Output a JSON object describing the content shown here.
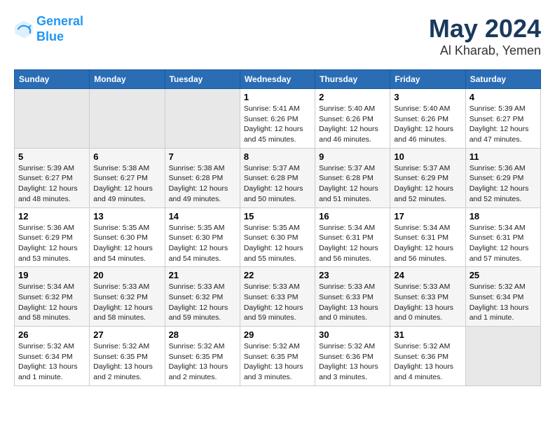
{
  "logo": {
    "line1": "General",
    "line2": "Blue"
  },
  "title": "May 2024",
  "subtitle": "Al Kharab, Yemen",
  "weekdays": [
    "Sunday",
    "Monday",
    "Tuesday",
    "Wednesday",
    "Thursday",
    "Friday",
    "Saturday"
  ],
  "weeks": [
    [
      {
        "day": "",
        "info": ""
      },
      {
        "day": "",
        "info": ""
      },
      {
        "day": "",
        "info": ""
      },
      {
        "day": "1",
        "info": "Sunrise: 5:41 AM\nSunset: 6:26 PM\nDaylight: 12 hours\nand 45 minutes."
      },
      {
        "day": "2",
        "info": "Sunrise: 5:40 AM\nSunset: 6:26 PM\nDaylight: 12 hours\nand 46 minutes."
      },
      {
        "day": "3",
        "info": "Sunrise: 5:40 AM\nSunset: 6:26 PM\nDaylight: 12 hours\nand 46 minutes."
      },
      {
        "day": "4",
        "info": "Sunrise: 5:39 AM\nSunset: 6:27 PM\nDaylight: 12 hours\nand 47 minutes."
      }
    ],
    [
      {
        "day": "5",
        "info": "Sunrise: 5:39 AM\nSunset: 6:27 PM\nDaylight: 12 hours\nand 48 minutes."
      },
      {
        "day": "6",
        "info": "Sunrise: 5:38 AM\nSunset: 6:27 PM\nDaylight: 12 hours\nand 49 minutes."
      },
      {
        "day": "7",
        "info": "Sunrise: 5:38 AM\nSunset: 6:28 PM\nDaylight: 12 hours\nand 49 minutes."
      },
      {
        "day": "8",
        "info": "Sunrise: 5:37 AM\nSunset: 6:28 PM\nDaylight: 12 hours\nand 50 minutes."
      },
      {
        "day": "9",
        "info": "Sunrise: 5:37 AM\nSunset: 6:28 PM\nDaylight: 12 hours\nand 51 minutes."
      },
      {
        "day": "10",
        "info": "Sunrise: 5:37 AM\nSunset: 6:29 PM\nDaylight: 12 hours\nand 52 minutes."
      },
      {
        "day": "11",
        "info": "Sunrise: 5:36 AM\nSunset: 6:29 PM\nDaylight: 12 hours\nand 52 minutes."
      }
    ],
    [
      {
        "day": "12",
        "info": "Sunrise: 5:36 AM\nSunset: 6:29 PM\nDaylight: 12 hours\nand 53 minutes."
      },
      {
        "day": "13",
        "info": "Sunrise: 5:35 AM\nSunset: 6:30 PM\nDaylight: 12 hours\nand 54 minutes."
      },
      {
        "day": "14",
        "info": "Sunrise: 5:35 AM\nSunset: 6:30 PM\nDaylight: 12 hours\nand 54 minutes."
      },
      {
        "day": "15",
        "info": "Sunrise: 5:35 AM\nSunset: 6:30 PM\nDaylight: 12 hours\nand 55 minutes."
      },
      {
        "day": "16",
        "info": "Sunrise: 5:34 AM\nSunset: 6:31 PM\nDaylight: 12 hours\nand 56 minutes."
      },
      {
        "day": "17",
        "info": "Sunrise: 5:34 AM\nSunset: 6:31 PM\nDaylight: 12 hours\nand 56 minutes."
      },
      {
        "day": "18",
        "info": "Sunrise: 5:34 AM\nSunset: 6:31 PM\nDaylight: 12 hours\nand 57 minutes."
      }
    ],
    [
      {
        "day": "19",
        "info": "Sunrise: 5:34 AM\nSunset: 6:32 PM\nDaylight: 12 hours\nand 58 minutes."
      },
      {
        "day": "20",
        "info": "Sunrise: 5:33 AM\nSunset: 6:32 PM\nDaylight: 12 hours\nand 58 minutes."
      },
      {
        "day": "21",
        "info": "Sunrise: 5:33 AM\nSunset: 6:32 PM\nDaylight: 12 hours\nand 59 minutes."
      },
      {
        "day": "22",
        "info": "Sunrise: 5:33 AM\nSunset: 6:33 PM\nDaylight: 12 hours\nand 59 minutes."
      },
      {
        "day": "23",
        "info": "Sunrise: 5:33 AM\nSunset: 6:33 PM\nDaylight: 13 hours\nand 0 minutes."
      },
      {
        "day": "24",
        "info": "Sunrise: 5:33 AM\nSunset: 6:33 PM\nDaylight: 13 hours\nand 0 minutes."
      },
      {
        "day": "25",
        "info": "Sunrise: 5:32 AM\nSunset: 6:34 PM\nDaylight: 13 hours\nand 1 minute."
      }
    ],
    [
      {
        "day": "26",
        "info": "Sunrise: 5:32 AM\nSunset: 6:34 PM\nDaylight: 13 hours\nand 1 minute."
      },
      {
        "day": "27",
        "info": "Sunrise: 5:32 AM\nSunset: 6:35 PM\nDaylight: 13 hours\nand 2 minutes."
      },
      {
        "day": "28",
        "info": "Sunrise: 5:32 AM\nSunset: 6:35 PM\nDaylight: 13 hours\nand 2 minutes."
      },
      {
        "day": "29",
        "info": "Sunrise: 5:32 AM\nSunset: 6:35 PM\nDaylight: 13 hours\nand 3 minutes."
      },
      {
        "day": "30",
        "info": "Sunrise: 5:32 AM\nSunset: 6:36 PM\nDaylight: 13 hours\nand 3 minutes."
      },
      {
        "day": "31",
        "info": "Sunrise: 5:32 AM\nSunset: 6:36 PM\nDaylight: 13 hours\nand 4 minutes."
      },
      {
        "day": "",
        "info": ""
      }
    ]
  ]
}
